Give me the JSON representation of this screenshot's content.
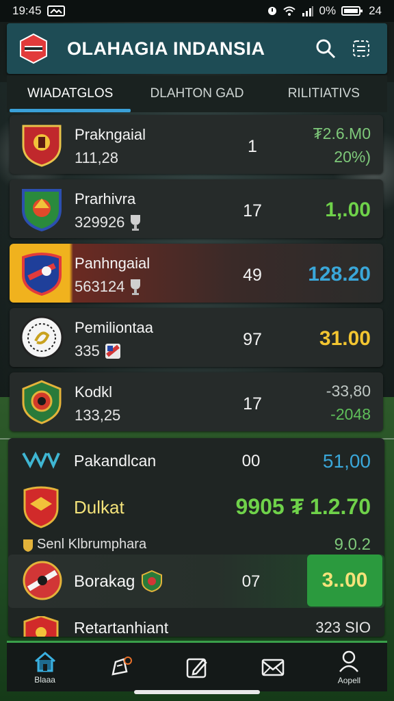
{
  "status_bar": {
    "time": "19:45",
    "battery_text": "0%",
    "right_number": "24"
  },
  "app": {
    "title": "OLAHAGIA INDANSIA"
  },
  "tabs": [
    {
      "label": "WIADATGLOS",
      "active": true
    },
    {
      "label": "DLAHTON GAD",
      "active": false
    },
    {
      "label": "RILITIATIVS",
      "active": false
    }
  ],
  "rows": [
    {
      "name": "Prakngaial",
      "sub": "111,28",
      "num": "1",
      "val_top": "₮2.6.M0",
      "val_bot": "20%)",
      "val_top_color": "#7ec97a",
      "val_bot_color": "#7ec97a"
    },
    {
      "name": "Prarhivra",
      "sub": "329926",
      "num": "17",
      "val": "1,.00",
      "val_color": "#6fd24a"
    },
    {
      "name": "Panhngaial",
      "sub": "563124",
      "num": "49",
      "val": "128.20",
      "val_color": "#3aa7d9",
      "highlight": true
    },
    {
      "name": "Pemiliontaa",
      "sub": "335",
      "num": "97",
      "val": "31.00",
      "val_color": "#f2c531"
    },
    {
      "name": "Kodkl",
      "sub": "133,25",
      "num": "17",
      "val_top": "-33,80",
      "val_bot": "-2048",
      "val_top_color": "#bfc7c4",
      "val_bot_color": "#5fbf5a"
    }
  ],
  "section2": {
    "row1": {
      "name": "Pakandlcan",
      "num": "00",
      "val": "51,00",
      "val_color": "#3aa7d9"
    },
    "row2": {
      "name": "Dulkat",
      "val": "9905 ₮ 1.2.70",
      "val_color": "#6fd24a"
    },
    "row3": {
      "name": "Senl Klbrumphara",
      "val": "9.0.2",
      "val_color": "#7ec97a"
    },
    "row4": {
      "name": "Borakag",
      "num": "07",
      "val": "3..00"
    },
    "row5": {
      "name": "Retartanhiant",
      "val": "323 SIO"
    }
  },
  "nav": [
    {
      "label": "Blaaa",
      "icon": "home-icon"
    },
    {
      "label": "",
      "icon": "news-icon"
    },
    {
      "label": "",
      "icon": "edit-icon"
    },
    {
      "label": "",
      "icon": "mail-icon"
    },
    {
      "label": "Aopell",
      "icon": "profile-icon"
    }
  ]
}
